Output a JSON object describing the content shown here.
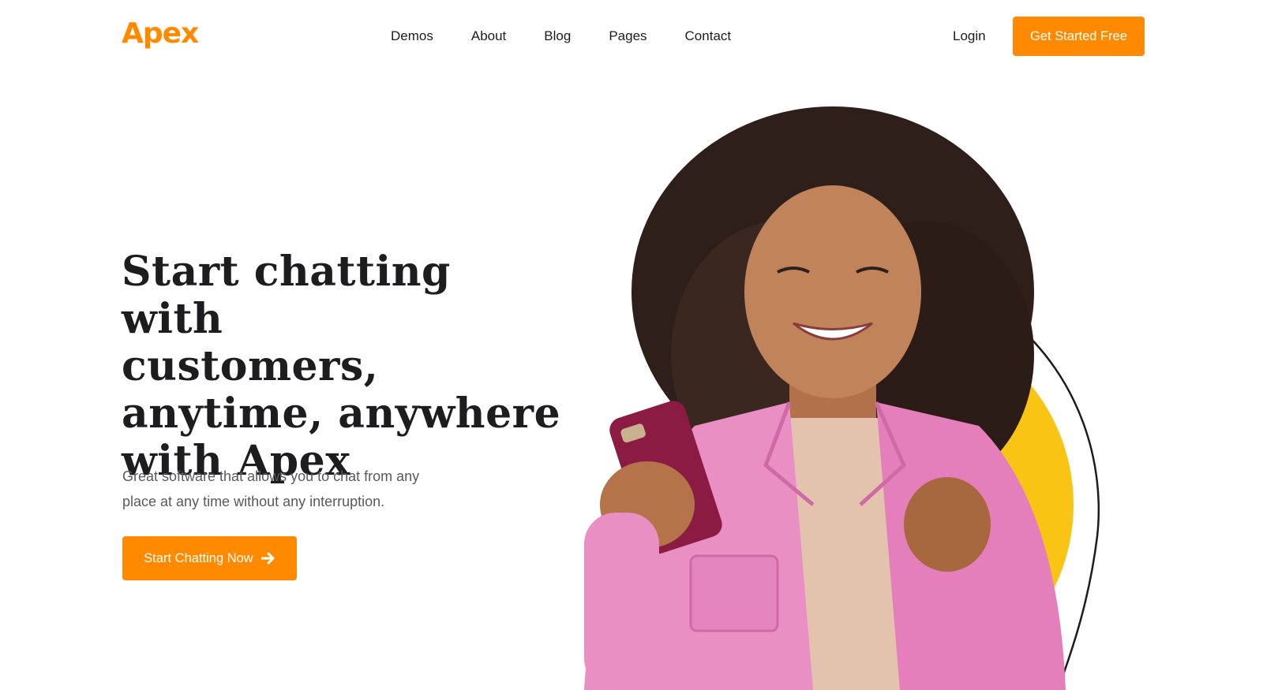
{
  "brand": {
    "name": "Apex",
    "color": "#ff8a00"
  },
  "nav": {
    "items": [
      {
        "label": "Demos"
      },
      {
        "label": "About"
      },
      {
        "label": "Blog"
      },
      {
        "label": "Pages"
      },
      {
        "label": "Contact"
      }
    ],
    "login_label": "Login",
    "cta_label": "Get Started Free"
  },
  "hero": {
    "title_lines": [
      "Start chatting with",
      "customers,",
      "anytime, anywhere",
      "with Apex"
    ],
    "subtitle_lines": [
      "Great software that allows you to chat from any",
      "place at any time without any interruption."
    ],
    "cta_label": "Start Chatting Now",
    "cta_icon": "arrow-right-icon"
  },
  "colors": {
    "accent": "#ff8a00",
    "yellow_circle": "#f9c413",
    "jacket": "#e98fc4",
    "phone": "#8b1b43"
  }
}
